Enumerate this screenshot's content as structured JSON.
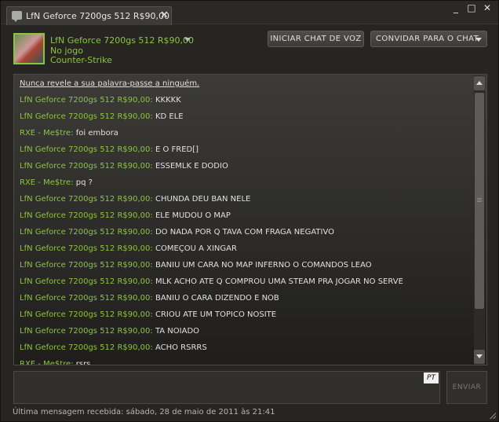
{
  "window": {
    "tab_title": "LfN Geforce 7200gs 512 R$90,00",
    "tab_close": "✕",
    "minimize": "_",
    "maximize": "□",
    "close": "✕"
  },
  "friend": {
    "name": "LfN Geforce 7200gs 512 R$90,00",
    "status": "No jogo",
    "game": "Counter-Strike"
  },
  "header_buttons": {
    "voice_chat": "INICIAR CHAT DE VOZ",
    "invite": "CONVIDAR PARA O CHAT"
  },
  "chat": {
    "warning": "Nunca revele a sua palavra-passe a ninguém.",
    "messages": [
      {
        "sender": "LfN Geforce 7200gs 512 R$90,00:",
        "text": " KKKKK"
      },
      {
        "sender": "LfN Geforce 7200gs 512 R$90,00:",
        "text": " KD ELE"
      },
      {
        "sender": "RXE - Me$tre:",
        "text": " foi embora"
      },
      {
        "sender": "LfN Geforce 7200gs 512 R$90,00:",
        "text": " E O FRED[]"
      },
      {
        "sender": "LfN Geforce 7200gs 512 R$90,00:",
        "text": " ESSEMLK E DODIO"
      },
      {
        "sender": "RXE - Me$tre:",
        "text": " pq ?"
      },
      {
        "sender": "LfN Geforce 7200gs 512 R$90,00:",
        "text": " CHUNDA DEU BAN NELE"
      },
      {
        "sender": "LfN Geforce 7200gs 512 R$90,00:",
        "text": " ELE MUDOU O MAP"
      },
      {
        "sender": "LfN Geforce 7200gs 512 R$90,00:",
        "text": " DO NADA POR Q TAVA COM FRAGA NEGATIVO"
      },
      {
        "sender": "LfN Geforce 7200gs 512 R$90,00:",
        "text": " COMEÇOU A XINGAR"
      },
      {
        "sender": "LfN Geforce 7200gs 512 R$90,00:",
        "text": " BANIU UM CARA NO MAP INFERNO O COMANDOS LEAO"
      },
      {
        "sender": "LfN Geforce 7200gs 512 R$90,00:",
        "text": " MLK ACHO ATE Q COMPROU UMA STEAM PRA JOGAR NO SERVE"
      },
      {
        "sender": "LfN Geforce 7200gs 512 R$90,00:",
        "text": " BANIU O CARA DIZENDO E NOB"
      },
      {
        "sender": "LfN Geforce 7200gs 512 R$90,00:",
        "text": " CRIOU ATE UM TOPICO NOSITE"
      },
      {
        "sender": "LfN Geforce 7200gs 512 R$90,00:",
        "text": " TA NOIADO"
      },
      {
        "sender": "LfN Geforce 7200gs 512 R$90,00:",
        "text": " ACHO RSRRS"
      },
      {
        "sender": "RXE - Me$tre:",
        "text": " rsrs"
      }
    ]
  },
  "input": {
    "language": "PT",
    "send_label": "ENVIAR"
  },
  "footer": {
    "last_message": "Última mensagem recebida: sábado, 28 de maio de 2011 às 21:41"
  }
}
